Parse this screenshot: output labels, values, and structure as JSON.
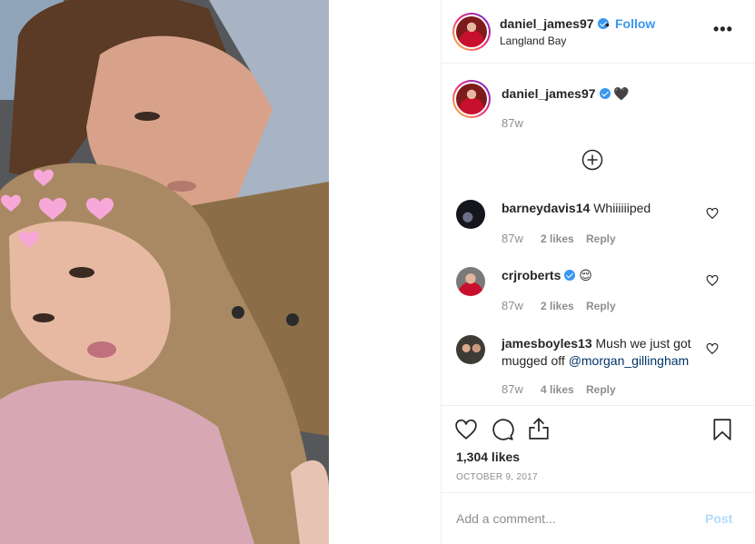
{
  "header": {
    "username": "daniel_james97",
    "dot": "•",
    "follow_label": "Follow",
    "location": "Langland Bay",
    "more_label": "•••"
  },
  "caption": {
    "username": "daniel_james97",
    "text": "🖤",
    "time": "87w"
  },
  "comments": [
    {
      "username": "barneydavis14",
      "text": "Whiiiiiiped",
      "time": "87w",
      "likes": "2 likes",
      "reply": "Reply",
      "verified": false
    },
    {
      "username": "crjroberts",
      "text": "😌",
      "time": "87w",
      "likes": "2 likes",
      "reply": "Reply",
      "verified": true
    },
    {
      "username": "jamesboyles13",
      "text": "Mush we just got mugged off ",
      "mention": "@morgan_gillingham",
      "time": "87w",
      "likes": "4 likes",
      "reply": "Reply",
      "verified": false
    }
  ],
  "actions": {
    "likes": "1,304 likes",
    "date": "OCTOBER 9, 2017"
  },
  "add_comment": {
    "placeholder": "Add a comment...",
    "post_label": "Post"
  },
  "colors": {
    "accent": "#3897f0",
    "muted": "#8e8e8e",
    "border": "#efefef",
    "post_disabled": "#b3dbff"
  }
}
